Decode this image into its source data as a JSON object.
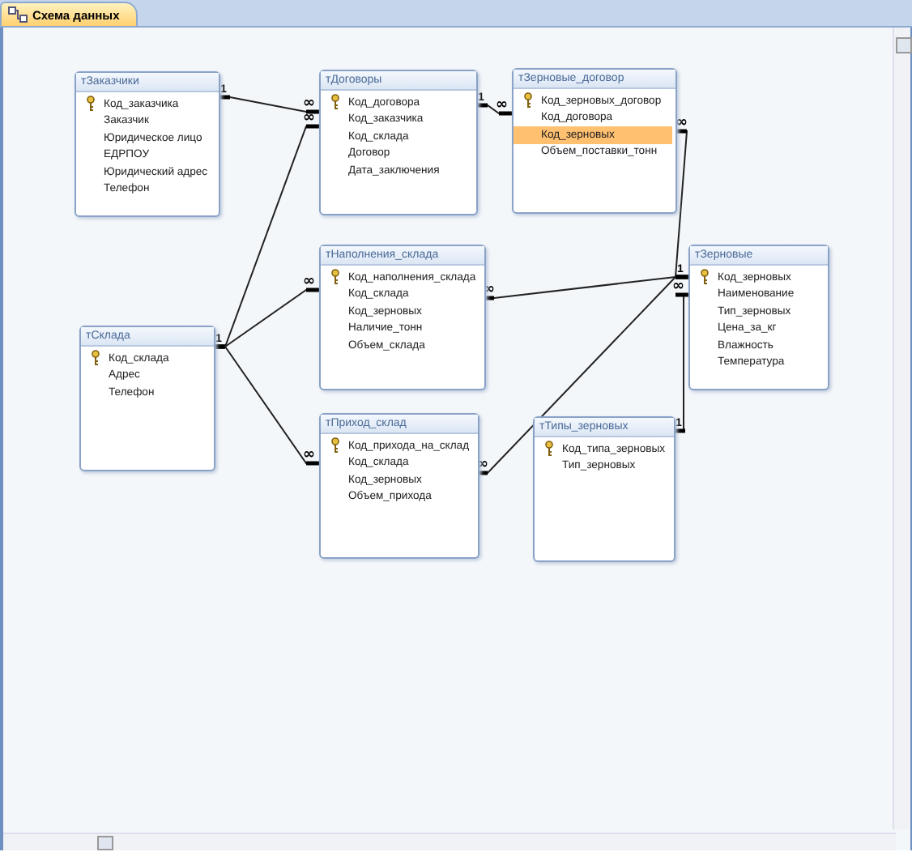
{
  "tab": {
    "label": "Схема данных",
    "selected": true
  },
  "tables": [
    {
      "title": "тЗаказчики",
      "fields": [
        {
          "name": "Код_заказчика",
          "key": true,
          "selected": false
        },
        {
          "name": "Заказчик",
          "key": false,
          "selected": false
        },
        {
          "name": "Юридическое лицо",
          "key": false,
          "selected": false
        },
        {
          "name": "ЕДРПОУ",
          "key": false,
          "selected": false
        },
        {
          "name": "Юридический адрес",
          "key": false,
          "selected": false
        },
        {
          "name": "Телефон",
          "key": false,
          "selected": false
        }
      ]
    },
    {
      "title": "тДоговоры",
      "fields": [
        {
          "name": "Код_договора",
          "key": true,
          "selected": false
        },
        {
          "name": "Код_заказчика",
          "key": false,
          "selected": false
        },
        {
          "name": "Код_склада",
          "key": false,
          "selected": false
        },
        {
          "name": "Договор",
          "key": false,
          "selected": false
        },
        {
          "name": "Дата_заключения",
          "key": false,
          "selected": false
        }
      ]
    },
    {
      "title": "тЗерновые_договор",
      "fields": [
        {
          "name": "Код_зерновых_договор",
          "key": true,
          "selected": false
        },
        {
          "name": "Код_договора",
          "key": false,
          "selected": false
        },
        {
          "name": "Код_зерновых",
          "key": false,
          "selected": true
        },
        {
          "name": "Объем_поставки_тонн",
          "key": false,
          "selected": false
        }
      ]
    },
    {
      "title": "тНаполнения_склада",
      "fields": [
        {
          "name": "Код_наполнения_склада",
          "key": true,
          "selected": false
        },
        {
          "name": "Код_склада",
          "key": false,
          "selected": false
        },
        {
          "name": "Код_зерновых",
          "key": false,
          "selected": false
        },
        {
          "name": "Наличие_тонн",
          "key": false,
          "selected": false
        },
        {
          "name": "Объем_склада",
          "key": false,
          "selected": false
        }
      ]
    },
    {
      "title": "тСклада",
      "fields": [
        {
          "name": "Код_склада",
          "key": true,
          "selected": false
        },
        {
          "name": "Адрес",
          "key": false,
          "selected": false
        },
        {
          "name": "Телефон",
          "key": false,
          "selected": false
        }
      ]
    },
    {
      "title": "тЗерновые",
      "fields": [
        {
          "name": "Код_зерновых",
          "key": true,
          "selected": false
        },
        {
          "name": "Наименование",
          "key": false,
          "selected": false
        },
        {
          "name": "Тип_зерновых",
          "key": false,
          "selected": false
        },
        {
          "name": "Цена_за_кг",
          "key": false,
          "selected": false
        },
        {
          "name": "Влажность",
          "key": false,
          "selected": false
        },
        {
          "name": "Температура",
          "key": false,
          "selected": false
        }
      ]
    },
    {
      "title": "тПриход_склад",
      "fields": [
        {
          "name": "Код_прихода_на_склад",
          "key": true,
          "selected": false
        },
        {
          "name": "Код_склада",
          "key": false,
          "selected": false
        },
        {
          "name": "Код_зерновых",
          "key": false,
          "selected": false
        },
        {
          "name": "Объем_прихода",
          "key": false,
          "selected": false
        }
      ]
    },
    {
      "title": "тТипы_зерновых",
      "fields": [
        {
          "name": "Код_типа_зерновых",
          "key": true,
          "selected": false
        },
        {
          "name": "Тип_зерновых",
          "key": false,
          "selected": false
        }
      ]
    }
  ],
  "relationships": [
    {
      "one": "1",
      "many": "∞"
    },
    {
      "one": "1",
      "many": "∞"
    },
    {
      "one": "1",
      "many": "∞"
    },
    {
      "many": "∞"
    },
    {
      "many": "∞"
    },
    {
      "one": "1",
      "many": "∞"
    },
    {
      "many": "∞"
    },
    {
      "many": "∞"
    },
    {
      "one": "1",
      "many": "∞"
    }
  ]
}
